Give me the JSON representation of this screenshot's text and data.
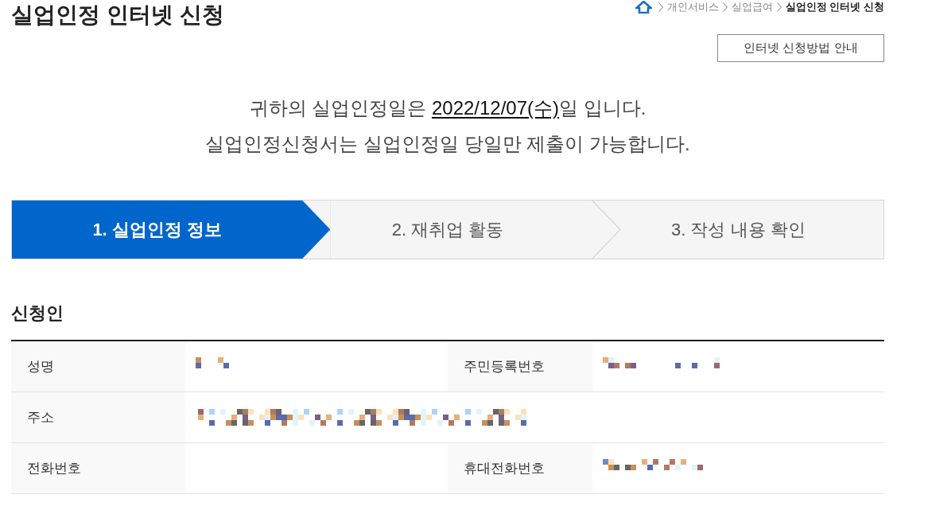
{
  "header": {
    "title": "실업인정 인터넷 신청",
    "breadcrumb": [
      {
        "label": "개인서비스",
        "current": false
      },
      {
        "label": "실업급여",
        "current": false
      },
      {
        "label": "실업인정 인터넷 신청",
        "current": true
      }
    ],
    "guide_button": "인터넷 신청방법 안내"
  },
  "notice": {
    "lines": [
      {
        "segments": [
          {
            "text": "귀하의 실업인정일은 ",
            "underline": false
          },
          {
            "text": "2022/12/07(수)",
            "underline": true
          },
          {
            "text": "일 입니다.",
            "underline": false
          }
        ]
      },
      {
        "segments": [
          {
            "text": "실업인정신청서는 실업인정일 당일만 제출이 가능합니다.",
            "underline": false
          }
        ]
      }
    ]
  },
  "steps": [
    {
      "label": "1. 실업인정 정보",
      "current": true
    },
    {
      "label": "2. 재취업 활동",
      "current": false
    },
    {
      "label": "3. 작성 내용 확인",
      "current": false
    }
  ],
  "applicant": {
    "title": "신청인",
    "rows": [
      {
        "cells": [
          {
            "label": "성명",
            "redacted": true
          },
          {
            "label": "주민등록번호",
            "redacted": true
          }
        ]
      },
      {
        "cells": [
          {
            "label": "주소",
            "redacted": true
          }
        ]
      },
      {
        "cells": [
          {
            "label": "전화번호",
            "redacted": false
          },
          {
            "label": "휴대전화번호",
            "redacted": true
          }
        ]
      }
    ]
  }
}
